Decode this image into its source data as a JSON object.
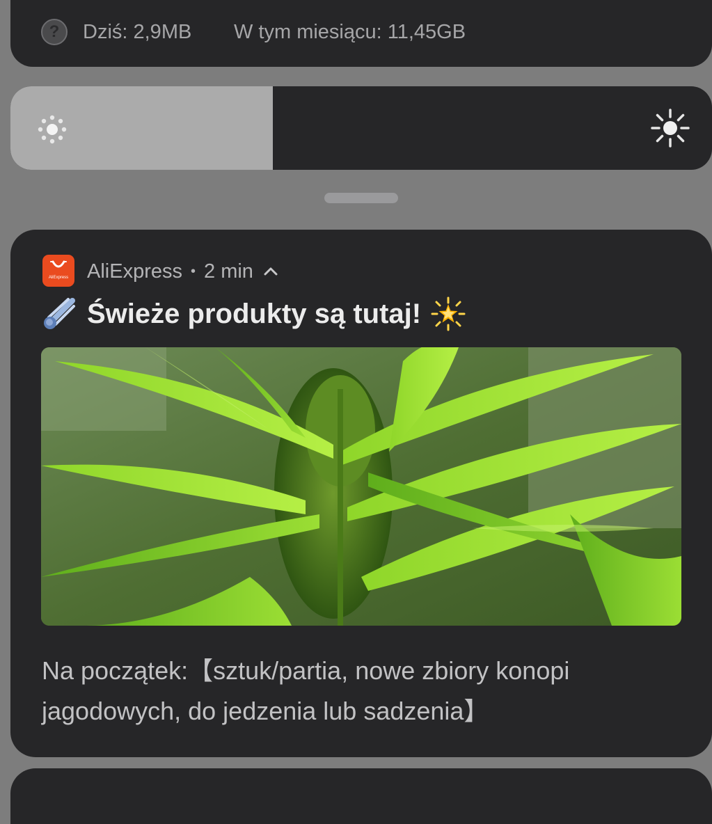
{
  "data_usage": {
    "today": "Dziś: 2,9MB",
    "month": "W tym miesiącu: 11,45GB"
  },
  "brightness": {
    "level": 0.374,
    "low_icon": "brightness-low-icon",
    "high_icon": "brightness-high-icon"
  },
  "notification": {
    "app_name": "AliExpress",
    "app_icon_text": "AliExpress",
    "separator": "•",
    "time": "2 min",
    "title": "Świeże produkty są tutaj!",
    "body": "Na początek:【sztuk/partia, nowe zbiory konopi jagodowych, do jedzenia lub sadzenia】",
    "image": "cannabis-plant-photo",
    "accent": "#ea4b1f"
  },
  "colors": {
    "panel_bg": "#262628",
    "screen_bg": "#7d7d7d",
    "brightness_fill": "#ababab"
  }
}
